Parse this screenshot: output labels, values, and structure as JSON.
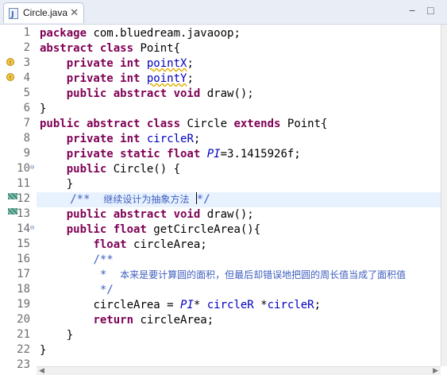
{
  "tab": {
    "title": "Circle.java",
    "close": "✕",
    "icon": "java-file-icon"
  },
  "window_controls": {
    "minimize": "−",
    "maximize": "□"
  },
  "line_numbers": [
    "1",
    "2",
    "3",
    "4",
    "5",
    "6",
    "7",
    "8",
    "9",
    "10",
    "11",
    "12",
    "13",
    "14",
    "15",
    "16",
    "17",
    "18",
    "19",
    "20",
    "21",
    "22",
    "23"
  ],
  "code": {
    "l1": {
      "kw": "package",
      "rest": " com.bluedream.javaoop;"
    },
    "l2": {
      "kw": "abstract class",
      "rest": " Point{"
    },
    "l3": {
      "kw": "private int",
      "field": "pointX",
      "rest": ";"
    },
    "l4": {
      "kw": "private int",
      "field": "pointY",
      "rest": ";"
    },
    "l5": {
      "kw": "public abstract void",
      "rest": " draw();"
    },
    "l6": {
      "rest": "}"
    },
    "l7": {
      "kw1": "public abstract class",
      "mid": " Circle ",
      "kw2": "extends",
      "rest": " Point{"
    },
    "l8": {
      "kw": "private int",
      "field": "circleR",
      "rest": ";"
    },
    "l9": {
      "kw": "private static float",
      "field": "PI",
      "rest": "=3.1415926f;"
    },
    "l10": {
      "kw": "public",
      "rest": " Circle() {"
    },
    "l11": {
      "rest": "}"
    },
    "l12": {
      "open": "/**",
      "cn": "继续设计为抽象方法",
      "close": "*/"
    },
    "l13": {
      "kw": "public abstract void",
      "rest": " draw();"
    },
    "l14": {
      "kw": "public float",
      "rest": " getCircleArea(){"
    },
    "l15": {
      "kw": "float",
      "rest": " circleArea;"
    },
    "l16": {
      "jdoc": "/**"
    },
    "l17": {
      "star": " *",
      "cn": "本来是要计算圆的面积，但最后却错误地把圆的周长值当成了面积值"
    },
    "l18": {
      "jdoc": " */"
    },
    "l19": {
      "a": "circleArea = ",
      "pi": "PI",
      "b": "* ",
      "r1": "circleR",
      "c": " *",
      "r2": "circleR",
      "d": ";"
    },
    "l20": {
      "kw": "return",
      "rest": " circleArea;"
    },
    "l21": {
      "rest": "}"
    },
    "l22": {
      "rest": "}"
    },
    "l23": {
      "rest": ""
    }
  }
}
